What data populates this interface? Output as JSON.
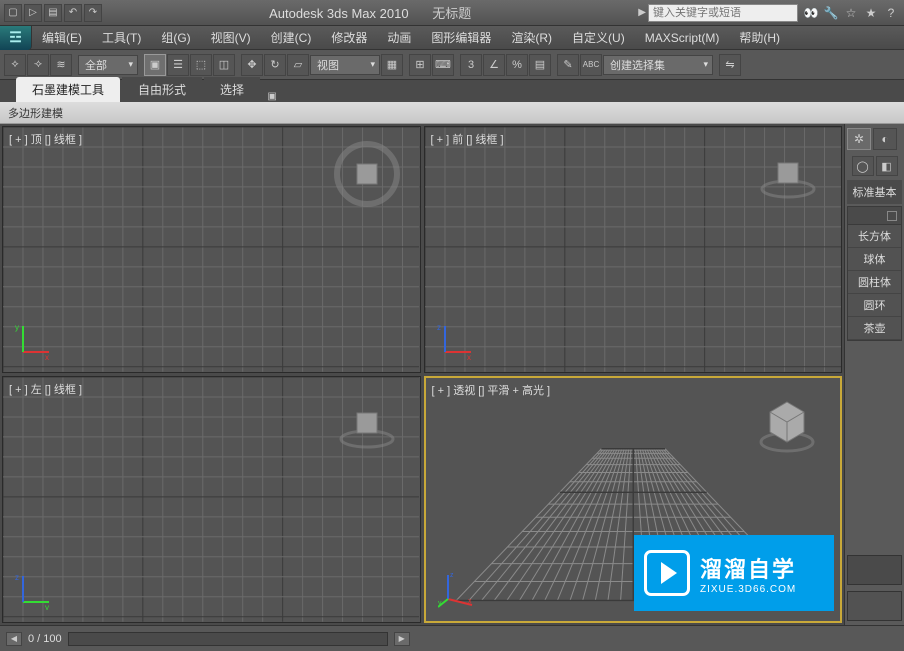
{
  "title": {
    "app": "Autodesk 3ds Max  2010",
    "doc": "无标题"
  },
  "search": {
    "placeholder": "键入关键字或短语"
  },
  "menu": [
    "编辑(E)",
    "工具(T)",
    "组(G)",
    "视图(V)",
    "创建(C)",
    "修改器",
    "动画",
    "图形编辑器",
    "渲染(R)",
    "自定义(U)",
    "MAXScript(M)",
    "帮助(H)"
  ],
  "toolbar": {
    "filter_dd": "全部",
    "view_dd": "视图",
    "set_dd": "创建选择集"
  },
  "ribbon": {
    "tabs": [
      "石墨建模工具",
      "自由形式",
      "选择"
    ],
    "panel": "多边形建模"
  },
  "viewports": {
    "tl": "[ + ] 顶 [] 线框 ]",
    "tr": "[ + ] 前 [] 线框 ]",
    "bl": "[ + ] 左 [] 线框 ]",
    "br": "[ + ] 透视 [] 平滑 + 高光 ]"
  },
  "cmd": {
    "category": "标准基本",
    "items": [
      "长方体",
      "球体",
      "圆柱体",
      "圆环",
      "茶壶"
    ]
  },
  "status": {
    "frame": "0 / 100"
  },
  "watermark": {
    "title": "溜溜自学",
    "sub": "ZIXUE.3D66.COM"
  }
}
